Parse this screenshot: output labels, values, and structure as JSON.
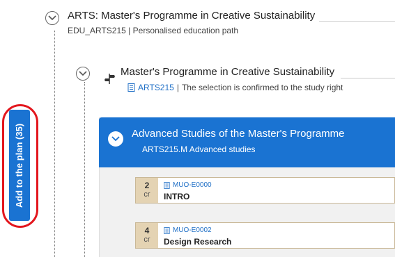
{
  "programme": {
    "title": "ARTS: Master's Programme in Creative Sustainability",
    "code": "EDU_ARTS215",
    "separator": "|",
    "subtitle": "Personalised education path"
  },
  "study_right": {
    "title": "Master's Programme in Creative Sustainability",
    "code": "ARTS215",
    "separator": "|",
    "note": "The selection is confirmed to the study right"
  },
  "module": {
    "title": "Advanced Studies of the Master's Programme",
    "subtitle": "ARTS215.M Advanced studies"
  },
  "courses": [
    {
      "credits": "2",
      "unit": "cr",
      "code": "MUO-E0000",
      "name": "INTRO"
    },
    {
      "credits": "4",
      "unit": "cr",
      "code": "MUO-E0002",
      "name": "Design Research"
    }
  ],
  "side_button": {
    "label": "Add to the plan (35)"
  },
  "colors": {
    "accent": "#1a73d2",
    "highlight": "#e3161d",
    "course_credit_bg": "#e4d3b3"
  },
  "icons": [
    "chevron-down-icon",
    "document-icon",
    "signpost-icon"
  ]
}
